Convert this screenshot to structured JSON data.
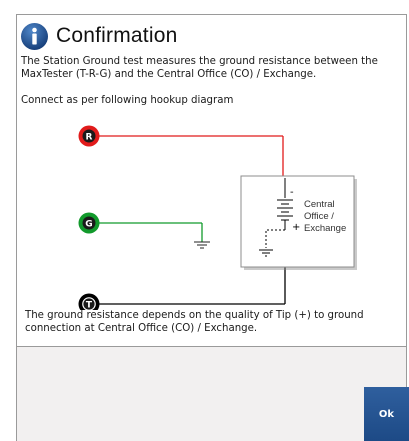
{
  "dialog": {
    "title": "Confirmation",
    "title_icon": "info-icon",
    "description": "The Station Ground test measures the ground resistance between the MaxTester (T-R-G) and the Central Office (CO) / Exchange.",
    "hookup_text": "Connect as per following hookup diagram",
    "footer_note": "The ground resistance depends on the quality of Tip (+) to ground connection at Central Office (CO) / Exchange.",
    "ok_label": "Ok"
  },
  "diagram": {
    "terminal_r": "R",
    "terminal_g": "G",
    "terminal_t": "T",
    "co_label_line1": "Central",
    "co_label_line2": "Office /",
    "co_label_line3": "Exchange",
    "battery_minus": "-",
    "battery_plus": "+",
    "colors": {
      "r_wire": "#e11b1b",
      "g_wire": "#129a2c",
      "t_wire": "#000000",
      "accent_button": "#1d4a86",
      "info_icon": "#1f4f91"
    }
  }
}
